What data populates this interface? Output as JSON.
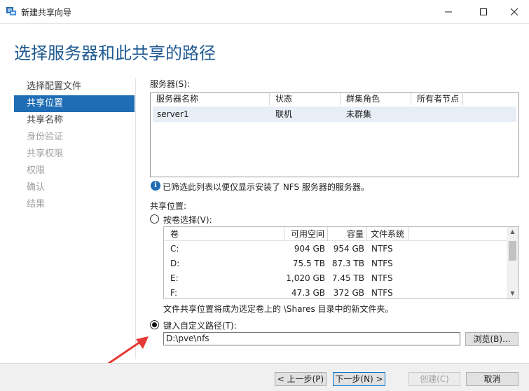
{
  "window": {
    "title": "新建共享向导",
    "min_icon": "minimize-icon",
    "max_icon": "maximize-icon",
    "close_icon": "close-icon"
  },
  "header": {
    "title": "选择服务器和此共享的路径"
  },
  "nav": {
    "items": [
      {
        "label": "选择配置文件",
        "state": "normal"
      },
      {
        "label": "共享位置",
        "state": "selected"
      },
      {
        "label": "共享名称",
        "state": "normal"
      },
      {
        "label": "身份验证",
        "state": "disabled"
      },
      {
        "label": "共享权限",
        "state": "disabled"
      },
      {
        "label": "权限",
        "state": "disabled"
      },
      {
        "label": "确认",
        "state": "disabled"
      },
      {
        "label": "结果",
        "state": "disabled"
      }
    ]
  },
  "servers": {
    "label": "服务器(S):",
    "columns": [
      "服务器名称",
      "状态",
      "群集角色",
      "所有者节点"
    ],
    "rows": [
      {
        "name": "server1",
        "status": "联机",
        "role": "未群集",
        "owner": ""
      }
    ],
    "info": "已筛选此列表以便仅显示安装了 NFS 服务器的服务器。"
  },
  "share_location": {
    "label": "共享位置:",
    "by_volume_label": "按卷选择(V):",
    "volume_columns": [
      "卷",
      "可用空间",
      "容量",
      "文件系统"
    ],
    "volumes": [
      {
        "vol": "C:",
        "free": "904 GB",
        "cap": "954 GB",
        "fs": "NTFS"
      },
      {
        "vol": "D:",
        "free": "75.5 TB",
        "cap": "87.3 TB",
        "fs": "NTFS"
      },
      {
        "vol": "E:",
        "free": "1,020 GB",
        "cap": "7.45 TB",
        "fs": "NTFS"
      },
      {
        "vol": "F:",
        "free": "47.3 GB",
        "cap": "372 GB",
        "fs": "NTFS"
      }
    ],
    "volume_note": "文件共享位置将成为选定卷上的 \\Shares 目录中的新文件夹。",
    "custom_path_label": "键入自定义路径(T):",
    "custom_path_value": "D:\\pve\\nfs",
    "browse_label": "浏览(B)...",
    "selected_option": "custom"
  },
  "footer": {
    "prev_label": "< 上一步(P)",
    "next_label": "下一步(N) >",
    "create_label": "创建(C)",
    "cancel_label": "取消"
  },
  "colors": {
    "accent": "#1e6db5",
    "title": "#1f5a92",
    "annotation_arrow": "#e53935"
  }
}
